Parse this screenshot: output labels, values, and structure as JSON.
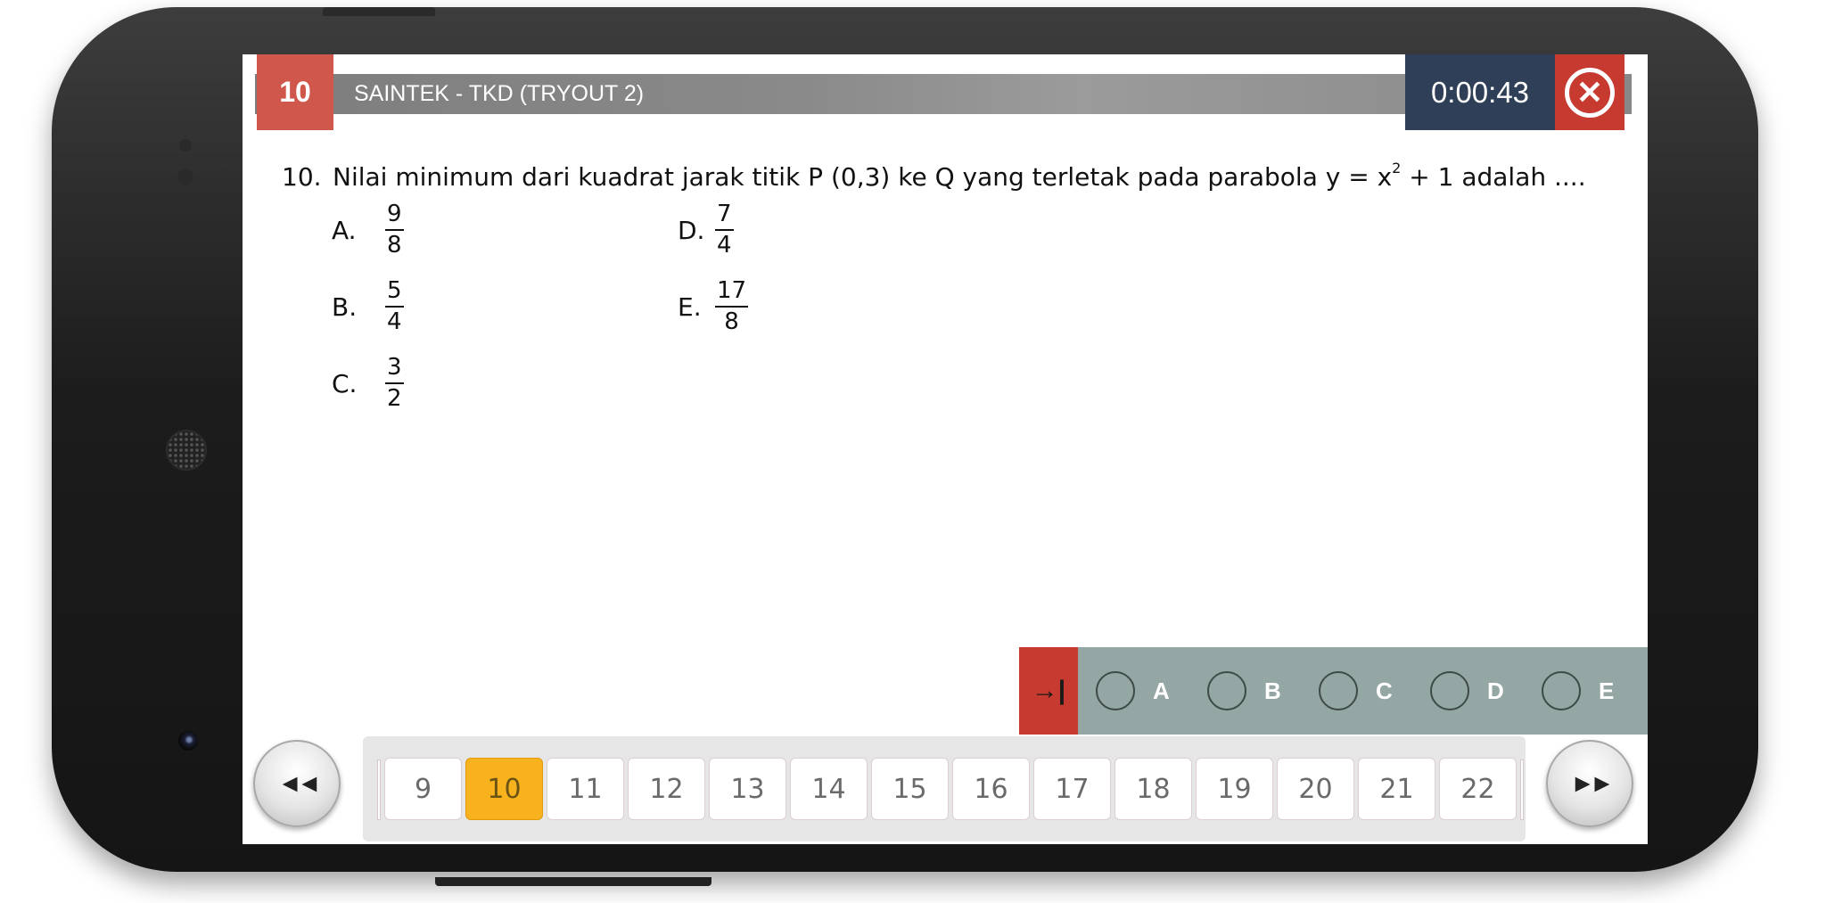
{
  "header": {
    "question_number": "10",
    "title": "SAINTEK - TKD (TRYOUT 2)",
    "timer": "0:00:43",
    "close_icon": "close-circle-icon"
  },
  "question": {
    "prefix": "10.",
    "text_before_exponent": "Nilai minimum dari kuadrat jarak titik P (0,3) ke Q yang terletak pada parabola y = x",
    "exponent": "2",
    "text_after_exponent": "+ 1 adalah ....",
    "options": [
      {
        "letter": "A.",
        "numerator": "9",
        "denominator": "8"
      },
      {
        "letter": "B.",
        "numerator": "5",
        "denominator": "4"
      },
      {
        "letter": "C.",
        "numerator": "3",
        "denominator": "2"
      },
      {
        "letter": "D.",
        "numerator": "7",
        "denominator": "4"
      },
      {
        "letter": "E.",
        "numerator": "17",
        "denominator": "8"
      }
    ]
  },
  "answer_bar": {
    "skip_icon": "skip-to-end-icon",
    "skip_glyph": "→|",
    "choices": [
      "A",
      "B",
      "C",
      "D",
      "E"
    ]
  },
  "navigation": {
    "prev_glyph": "◄◄",
    "next_glyph": "►►",
    "pages": [
      "9",
      "10",
      "11",
      "12",
      "13",
      "14",
      "15",
      "16",
      "17",
      "18",
      "19",
      "20",
      "21",
      "22"
    ],
    "current_page": "10"
  },
  "colors": {
    "accent_red": "#c63a2f",
    "question_box": "#d0574b",
    "timer_bg": "#2f3f57",
    "answer_bar": "#95a7a4",
    "active_page": "#f7b21e"
  }
}
